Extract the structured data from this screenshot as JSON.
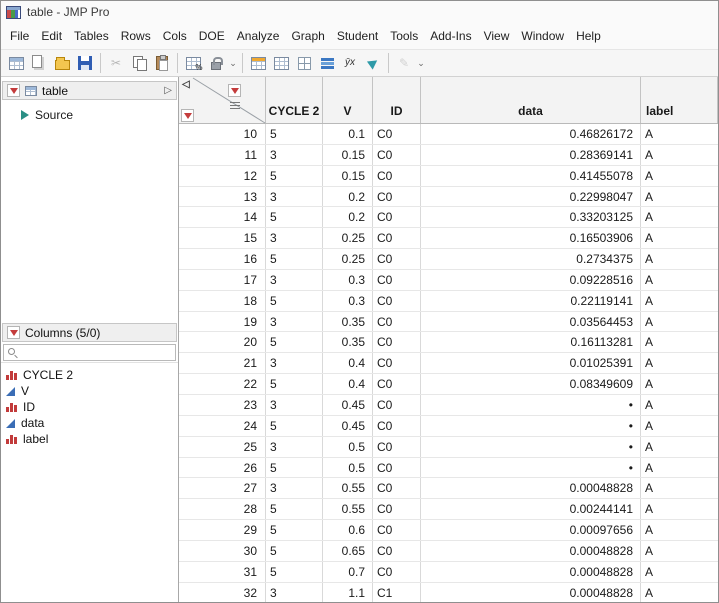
{
  "window": {
    "title": "table - JMP Pro"
  },
  "menubar": {
    "items": [
      "File",
      "Edit",
      "Tables",
      "Rows",
      "Cols",
      "DOE",
      "Analyze",
      "Graph",
      "Student",
      "Tools",
      "Add-Ins",
      "View",
      "Window",
      "Help"
    ]
  },
  "toolbar": {
    "icons": [
      "new-data-table-icon",
      "journal-icon",
      "open-icon",
      "save-icon",
      "cut-icon",
      "copy-icon",
      "paste-icon",
      "tabulate-icon",
      "lock-icon",
      "data-table-icon",
      "summary-table-icon",
      "split-table-icon",
      "graph-builder-icon",
      "fit-model-icon",
      "run-script-icon",
      "annotate-icon",
      "overflow-chevron-icon"
    ],
    "glyphs": {
      "cut": "✂",
      "fit_model": "ȳx",
      "annotate": "✎",
      "chevron": "⌄",
      "percent": "%"
    }
  },
  "side": {
    "table_panel": {
      "title": "table",
      "collapse_glyph": "▷"
    },
    "source_item": {
      "label": "Source"
    },
    "columns_panel": {
      "title": "Columns (5/0)"
    },
    "search": {
      "value": ""
    },
    "columns": [
      {
        "name": "CYCLE 2",
        "type": "nominal"
      },
      {
        "name": "V",
        "type": "continuous"
      },
      {
        "name": "ID",
        "type": "nominal"
      },
      {
        "name": "data",
        "type": "continuous"
      },
      {
        "name": "label",
        "type": "nominal"
      }
    ]
  },
  "grid": {
    "corner": {
      "collapse_glyph": "◁"
    },
    "headers": [
      "CYCLE 2",
      "V",
      "ID",
      "data",
      "label"
    ],
    "rows": [
      {
        "n": "10",
        "cycle": "5",
        "v": "0.1",
        "id": "C0",
        "data": "0.46826172",
        "label": "A"
      },
      {
        "n": "11",
        "cycle": "3",
        "v": "0.15",
        "id": "C0",
        "data": "0.28369141",
        "label": "A"
      },
      {
        "n": "12",
        "cycle": "5",
        "v": "0.15",
        "id": "C0",
        "data": "0.41455078",
        "label": "A"
      },
      {
        "n": "13",
        "cycle": "3",
        "v": "0.2",
        "id": "C0",
        "data": "0.22998047",
        "label": "A"
      },
      {
        "n": "14",
        "cycle": "5",
        "v": "0.2",
        "id": "C0",
        "data": "0.33203125",
        "label": "A"
      },
      {
        "n": "15",
        "cycle": "3",
        "v": "0.25",
        "id": "C0",
        "data": "0.16503906",
        "label": "A"
      },
      {
        "n": "16",
        "cycle": "5",
        "v": "0.25",
        "id": "C0",
        "data": "0.2734375",
        "label": "A"
      },
      {
        "n": "17",
        "cycle": "3",
        "v": "0.3",
        "id": "C0",
        "data": "0.09228516",
        "label": "A"
      },
      {
        "n": "18",
        "cycle": "5",
        "v": "0.3",
        "id": "C0",
        "data": "0.22119141",
        "label": "A"
      },
      {
        "n": "19",
        "cycle": "3",
        "v": "0.35",
        "id": "C0",
        "data": "0.03564453",
        "label": "A"
      },
      {
        "n": "20",
        "cycle": "5",
        "v": "0.35",
        "id": "C0",
        "data": "0.16113281",
        "label": "A"
      },
      {
        "n": "21",
        "cycle": "3",
        "v": "0.4",
        "id": "C0",
        "data": "0.01025391",
        "label": "A"
      },
      {
        "n": "22",
        "cycle": "5",
        "v": "0.4",
        "id": "C0",
        "data": "0.08349609",
        "label": "A"
      },
      {
        "n": "23",
        "cycle": "3",
        "v": "0.45",
        "id": "C0",
        "data": "•",
        "label": "A"
      },
      {
        "n": "24",
        "cycle": "5",
        "v": "0.45",
        "id": "C0",
        "data": "•",
        "label": "A"
      },
      {
        "n": "25",
        "cycle": "3",
        "v": "0.5",
        "id": "C0",
        "data": "•",
        "label": "A"
      },
      {
        "n": "26",
        "cycle": "5",
        "v": "0.5",
        "id": "C0",
        "data": "•",
        "label": "A"
      },
      {
        "n": "27",
        "cycle": "3",
        "v": "0.55",
        "id": "C0",
        "data": "0.00048828",
        "label": "A"
      },
      {
        "n": "28",
        "cycle": "5",
        "v": "0.55",
        "id": "C0",
        "data": "0.00244141",
        "label": "A"
      },
      {
        "n": "29",
        "cycle": "5",
        "v": "0.6",
        "id": "C0",
        "data": "0.00097656",
        "label": "A"
      },
      {
        "n": "30",
        "cycle": "5",
        "v": "0.65",
        "id": "C0",
        "data": "0.00048828",
        "label": "A"
      },
      {
        "n": "31",
        "cycle": "5",
        "v": "0.7",
        "id": "C0",
        "data": "0.00048828",
        "label": "A"
      },
      {
        "n": "32",
        "cycle": "3",
        "v": "1.1",
        "id": "C1",
        "data": "0.00048828",
        "label": "A"
      }
    ]
  }
}
